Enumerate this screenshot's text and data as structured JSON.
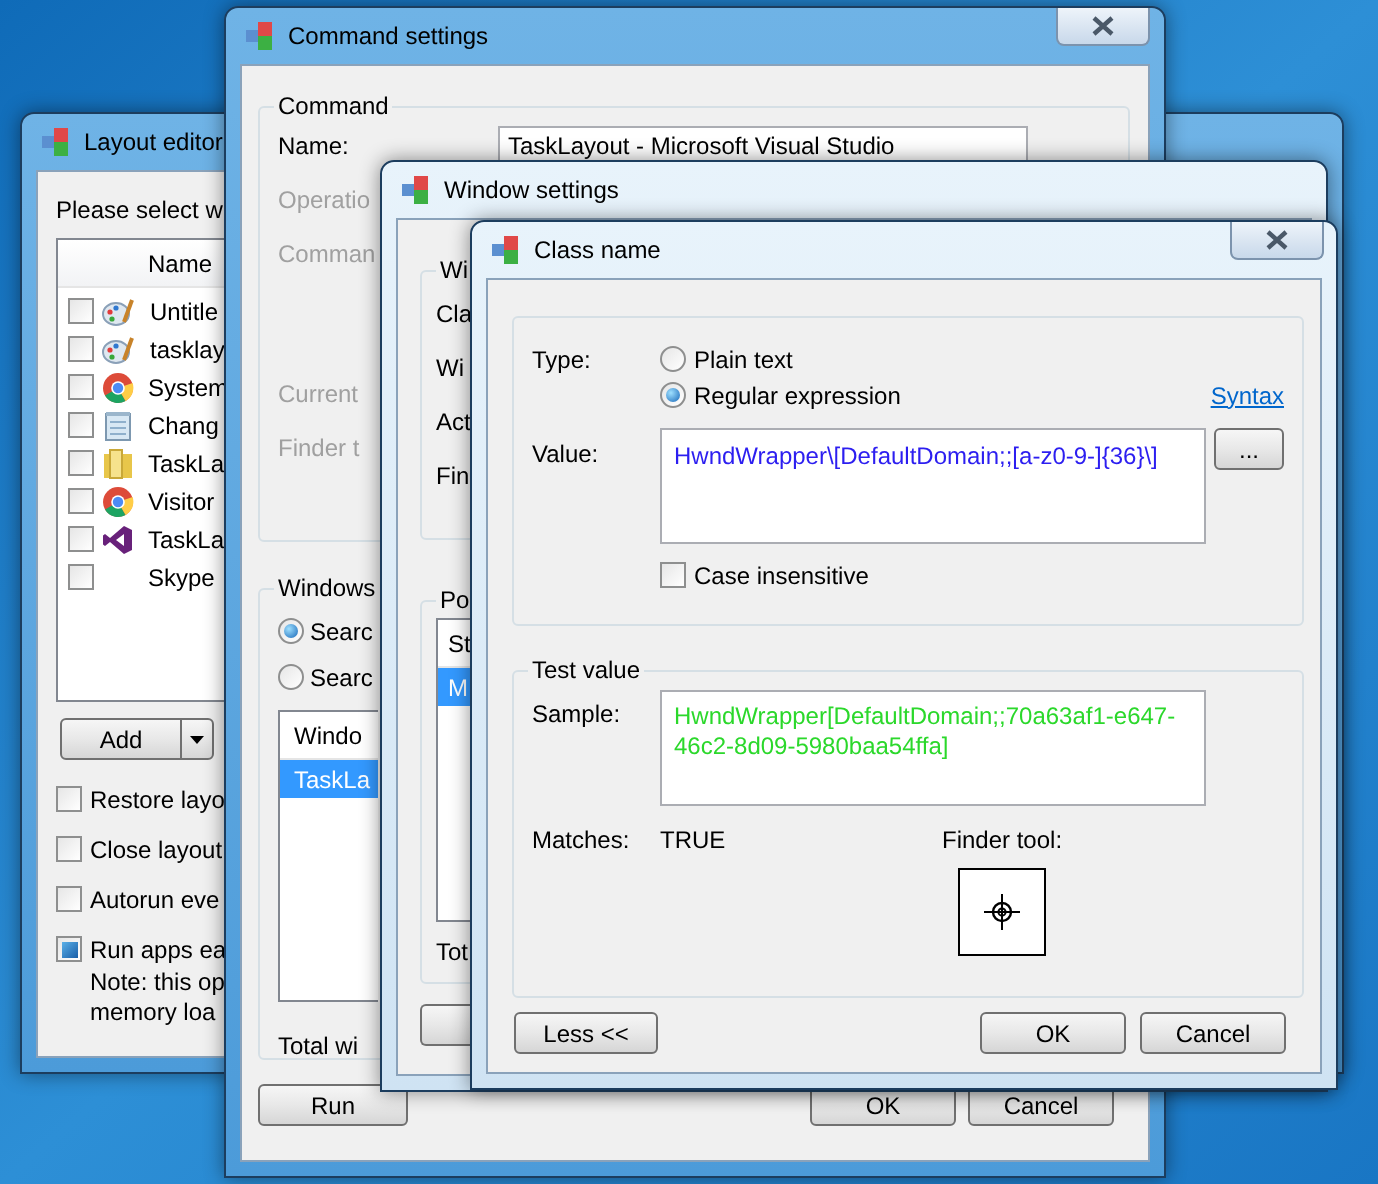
{
  "layout_editor": {
    "title": "Layout editor",
    "prompt": "Please select w",
    "list_header": "Name",
    "rows": [
      {
        "kind": "palette",
        "label": "Untitle",
        "checked": false
      },
      {
        "kind": "palette",
        "label": "tasklay",
        "checked": false
      },
      {
        "kind": "browser",
        "label": "System",
        "checked": false
      },
      {
        "kind": "notepad",
        "label": "Chang",
        "checked": false
      },
      {
        "kind": "folder",
        "label": "TaskLa",
        "checked": false
      },
      {
        "kind": "browser",
        "label": "Visitor",
        "checked": false
      },
      {
        "kind": "studio",
        "label": "TaskLa",
        "checked": false
      },
      {
        "kind": "none",
        "label": "Skype",
        "checked": false
      }
    ],
    "add_button": "Add",
    "options": [
      {
        "label": "Restore layo",
        "checked": false
      },
      {
        "label": "Close layout",
        "checked": false
      },
      {
        "label": "Autorun eve",
        "checked": false
      },
      {
        "label": "Run apps ea",
        "checked": true
      }
    ],
    "note_lines": [
      "Note: this op",
      "memory loa"
    ]
  },
  "command_settings": {
    "title": "Command settings",
    "group": "Command",
    "name_label": "Name:",
    "name_value": "TaskLayout - Microsoft Visual Studio",
    "labels": [
      {
        "text": "Operatio",
        "disabled": true
      },
      {
        "text": "Comman",
        "disabled": true
      },
      {
        "text": "Current",
        "disabled": true
      },
      {
        "text": "Finder t",
        "disabled": true
      }
    ],
    "windows_group": "Windows",
    "radios": [
      {
        "label": "Searc",
        "selected": true
      },
      {
        "label": "Searc",
        "selected": false
      }
    ],
    "list_header": "Windo",
    "list_rows": [
      {
        "label": "TaskLa",
        "selected": true
      }
    ],
    "total_label": "Total wi",
    "run_button": "Run",
    "ok_button": "OK",
    "cancel_button": "Cancel"
  },
  "window_settings": {
    "title": "Window settings",
    "group": "Wi",
    "labels": [
      "Cla",
      "Wi",
      "Act",
      "Fin"
    ],
    "position_group": "Po",
    "list_header": "St",
    "list_rows": [
      {
        "label": "M",
        "selected": true
      }
    ],
    "total_label": "Tot"
  },
  "class_name": {
    "title": "Class name",
    "type_label": "Type:",
    "types": [
      {
        "label": "Plain text",
        "selected": false
      },
      {
        "label": "Regular expression",
        "selected": true
      }
    ],
    "syntax_link": "Syntax",
    "value_label": "Value:",
    "value": "HwndWrapper\\[DefaultDomain;;[a-z0-9-]{36}\\]",
    "browse_button": "...",
    "case_insensitive": {
      "label": "Case insensitive",
      "checked": false
    },
    "test_group": "Test value",
    "sample_label": "Sample:",
    "sample": "HwndWrapper[DefaultDomain;;70a63af1-e647-46c2-8d09-5980baa54ffa]",
    "matches_label": "Matches:",
    "matches": "TRUE",
    "finder_label": "Finder tool:",
    "less_button": "Less <<",
    "ok_button": "OK",
    "cancel_button": "Cancel"
  }
}
